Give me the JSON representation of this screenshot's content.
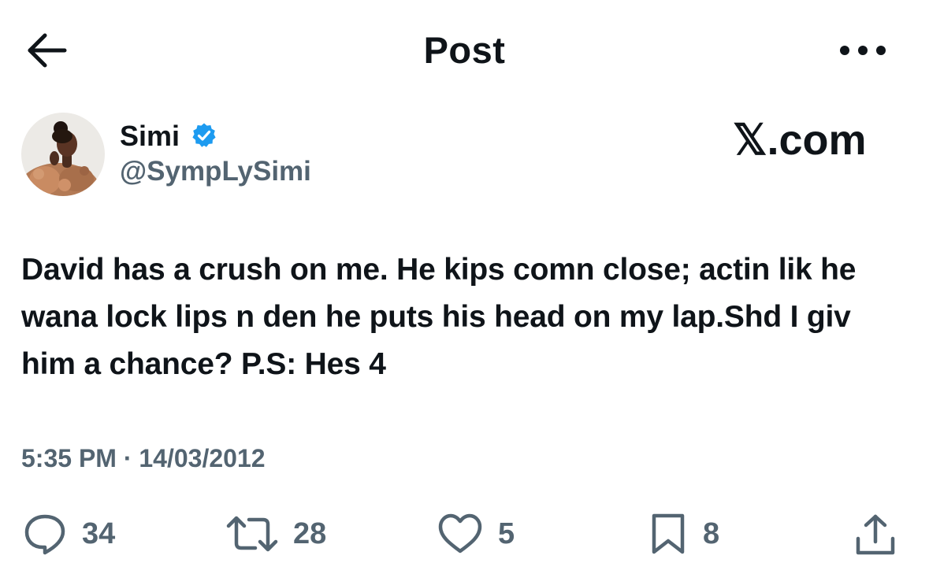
{
  "header": {
    "title": "Post"
  },
  "post": {
    "author": {
      "display_name": "Simi",
      "handle": "@SympLySimi",
      "verified": true
    },
    "watermark": "𝕏.com",
    "text": "David has a crush on me. He kips comn close; actin lik he wana lock lips n den he puts his head on my lap.Shd I giv him a chance? P.S: Hes 4",
    "timestamp": "5:35 PM · 14/03/2012",
    "stats": {
      "replies": "34",
      "reposts": "28",
      "likes": "5",
      "bookmarks": "8"
    }
  },
  "icons": {
    "back": "arrow-left-icon",
    "more": "more-horizontal-icon",
    "verified": "verified-badge-icon",
    "reply": "reply-bubble-icon",
    "repost": "repost-icon",
    "like": "heart-icon",
    "bookmark": "bookmark-icon",
    "share": "share-icon"
  },
  "colors": {
    "text": "#0f1419",
    "secondary": "#536471",
    "verified_blue": "#1d9bf0",
    "background": "#ffffff"
  }
}
